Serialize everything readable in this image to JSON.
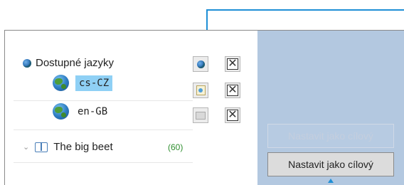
{
  "tree": {
    "root_label": "Dostupné jazyky",
    "languages": [
      {
        "code": "cs-CZ",
        "selected": true
      },
      {
        "code": "en-GB",
        "selected": false
      }
    ],
    "book": {
      "title": "The big beet",
      "count": "(60)"
    }
  },
  "buttons": {
    "disabled_label": "Nastavit jako cílový",
    "target_label": "Nastavit jako cílový"
  },
  "colors": {
    "panel_bg": "#b3c8e0",
    "selection_bg": "#8fd0f5",
    "arrow": "#1f8fd6",
    "count_text": "#2f8f2f"
  }
}
